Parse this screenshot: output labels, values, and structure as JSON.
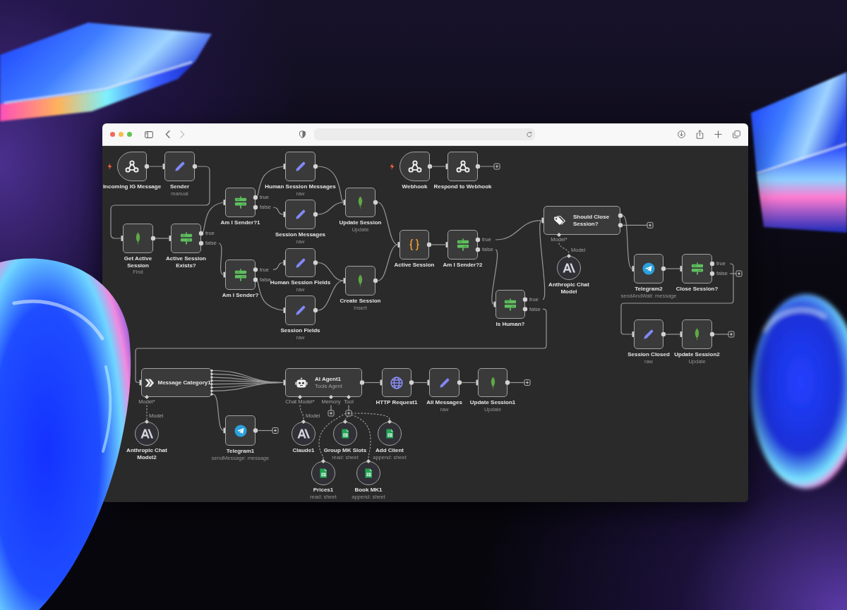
{
  "browser": {
    "back": {
      "disabled": false
    },
    "forward": {
      "disabled": true
    }
  },
  "workflow": {
    "nodes": [
      {
        "kind": "webhook",
        "trigger": true,
        "label": "Incoming IG Message"
      },
      {
        "kind": "set",
        "trigger": false,
        "label": "Sender",
        "subtitle": "manual"
      },
      {
        "kind": "set",
        "trigger": false,
        "label": "Human Session Messages",
        "subtitle": "raw"
      },
      {
        "kind": "webhook",
        "trigger": true,
        "label": "Webhook"
      },
      {
        "kind": "respond",
        "trigger": false,
        "label": "Respond to Webhook"
      },
      {
        "kind": "if",
        "trigger": false,
        "label": "Am I Sender?1",
        "outputs": [
          "true",
          "false"
        ]
      },
      {
        "kind": "set",
        "trigger": false,
        "label": "Session Messages",
        "subtitle": "raw"
      },
      {
        "kind": "mongodb",
        "trigger": false,
        "label": "Update Session",
        "subtitle": "Update"
      },
      {
        "kind": "classifier",
        "trigger": false,
        "label": "Should Close Session?",
        "inputs": [
          "Model*"
        ]
      },
      {
        "kind": "mongodb",
        "trigger": false,
        "label": "Get Active Session",
        "subtitle": "Find"
      },
      {
        "kind": "if",
        "trigger": false,
        "label": "Active Session Exists?",
        "outputs": [
          "true",
          "false"
        ]
      },
      {
        "kind": "code",
        "trigger": false,
        "label": "Active Session"
      },
      {
        "kind": "if",
        "trigger": false,
        "label": "Am I Sender?2",
        "outputs": [
          "true",
          "false"
        ]
      },
      {
        "kind": "if",
        "trigger": false,
        "label": "Am I Sender?",
        "outputs": [
          "true",
          "false"
        ]
      },
      {
        "kind": "set",
        "trigger": false,
        "label": "Human Session Fields",
        "subtitle": "raw"
      },
      {
        "kind": "mongodb",
        "trigger": false,
        "label": "Create Session",
        "subtitle": "Insert"
      },
      {
        "kind": "model",
        "label": "Anthropic Chat Model",
        "port_label": "Model"
      },
      {
        "kind": "telegram",
        "trigger": false,
        "label": "Telegram2",
        "subtitle": "sendAndWait: message"
      },
      {
        "kind": "if",
        "trigger": false,
        "label": "Close Session?",
        "outputs": [
          "true",
          "false"
        ]
      },
      {
        "kind": "set",
        "trigger": false,
        "label": "Session Fields",
        "subtitle": "raw"
      },
      {
        "kind": "if",
        "trigger": false,
        "label": "Is Human?",
        "outputs": [
          "true",
          "false"
        ]
      },
      {
        "kind": "set",
        "trigger": false,
        "label": "Session Closed",
        "subtitle": "raw"
      },
      {
        "kind": "mongodb",
        "trigger": false,
        "label": "Update Session2",
        "subtitle": "Update"
      },
      {
        "kind": "router",
        "trigger": false,
        "label": "Message Category1",
        "inputs": [
          "Model*"
        ]
      },
      {
        "kind": "agent",
        "trigger": false,
        "label": "AI Agent1",
        "subtitle": "Tools Agent",
        "inputs": [
          "Chat Model*",
          "Memory",
          "Tool"
        ]
      },
      {
        "kind": "http",
        "trigger": false,
        "label": "HTTP Request1"
      },
      {
        "kind": "set",
        "trigger": false,
        "label": "All Messages",
        "subtitle": "raw"
      },
      {
        "kind": "mongodb",
        "trigger": false,
        "label": "Update Session1",
        "subtitle": "Update"
      },
      {
        "kind": "model",
        "label": "Anthropic Chat Model2",
        "port_label": "Model"
      },
      {
        "kind": "telegram",
        "trigger": false,
        "label": "Telegram1",
        "subtitle": "sendMessage: message"
      },
      {
        "kind": "model",
        "label": "Claude1",
        "port_label": "Model"
      },
      {
        "kind": "sheets",
        "label": "Group MK Slots",
        "subtitle": "read: sheet"
      },
      {
        "kind": "sheets",
        "label": "Add Client",
        "subtitle": "append: sheet"
      },
      {
        "kind": "sheets",
        "label": "Prices1",
        "subtitle": "read: sheet"
      },
      {
        "kind": "sheets",
        "label": "Book MK1",
        "subtitle": "append: sheet"
      }
    ]
  }
}
